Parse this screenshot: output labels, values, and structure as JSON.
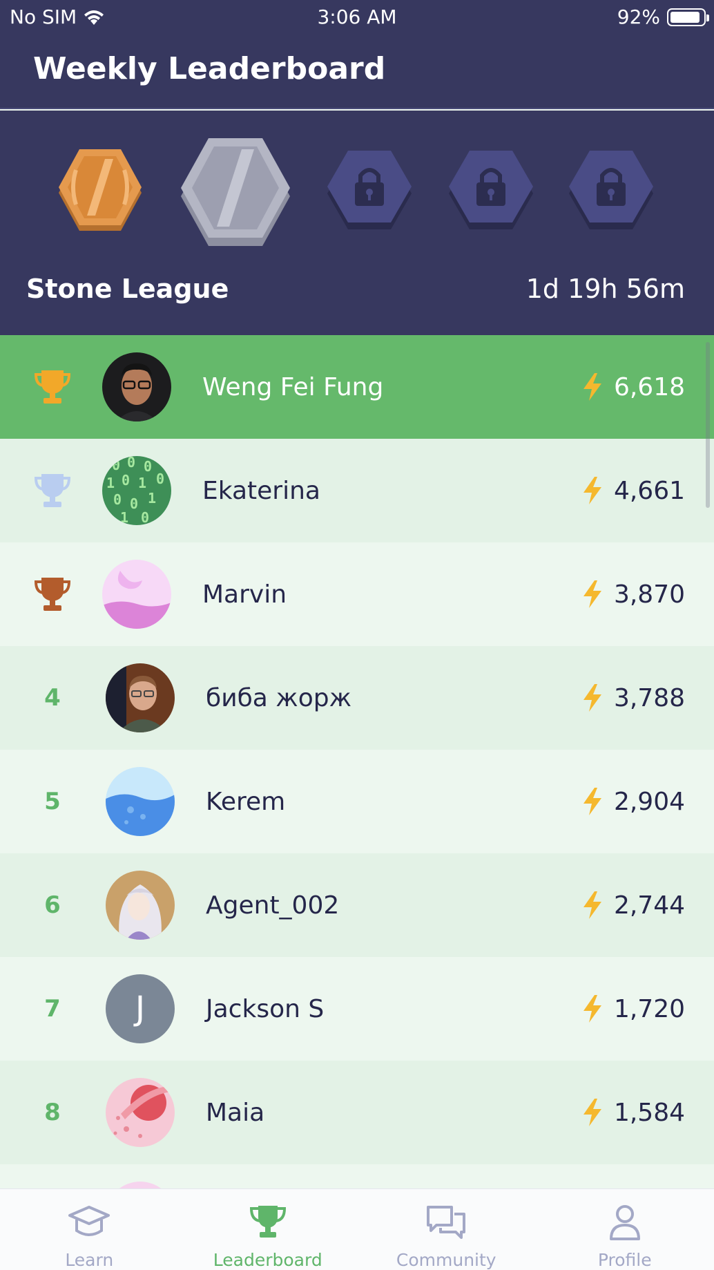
{
  "status_bar": {
    "carrier": "No SIM",
    "time": "3:06 AM",
    "battery": "92%",
    "battery_level": 0.92
  },
  "header": {
    "title": "Weekly Leaderboard"
  },
  "league": {
    "name": "Stone League",
    "countdown": "1d 19h 56m",
    "badges": [
      {
        "name": "bronze-league-badge",
        "state": "achieved"
      },
      {
        "name": "stone-league-badge",
        "state": "current"
      },
      {
        "name": "locked-league-badge-1",
        "state": "locked"
      },
      {
        "name": "locked-league-badge-2",
        "state": "locked"
      },
      {
        "name": "locked-league-badge-3",
        "state": "locked"
      }
    ]
  },
  "leaderboard": [
    {
      "rank": "1",
      "trophy": "gold",
      "name": "Weng Fei Fung",
      "score": "6,618",
      "avatar": "photo-man-glasses",
      "highlight": true
    },
    {
      "rank": "2",
      "trophy": "silver",
      "name": "Ekaterina",
      "score": "4,661",
      "avatar": "binary-code"
    },
    {
      "rank": "3",
      "trophy": "bronze",
      "name": "Marvin",
      "score": "3,870",
      "avatar": "pink-moon"
    },
    {
      "rank": "4",
      "name": "биба жорж",
      "score": "3,788",
      "avatar": "photo-man"
    },
    {
      "rank": "5",
      "name": "Kerem",
      "score": "2,904",
      "avatar": "blue-water"
    },
    {
      "rank": "6",
      "name": "Agent_002",
      "score": "2,744",
      "avatar": "anime-girl"
    },
    {
      "rank": "7",
      "name": "Jackson S",
      "score": "1,720",
      "avatar": "letter",
      "initial": "J"
    },
    {
      "rank": "8",
      "name": "Maia",
      "score": "1,584",
      "avatar": "pink-planet"
    }
  ],
  "tabs": [
    {
      "label": "Learn",
      "icon": "graduation-cap-icon",
      "active": false
    },
    {
      "label": "Leaderboard",
      "icon": "trophy-icon",
      "active": true
    },
    {
      "label": "Community",
      "icon": "chat-bubbles-icon",
      "active": false
    },
    {
      "label": "Profile",
      "icon": "person-icon",
      "active": false
    }
  ],
  "colors": {
    "header_bg": "#37385f",
    "highlight_row": "#65b96b",
    "row_a": "#e3f2e6",
    "row_b": "#edf7ef",
    "accent_green": "#5fb56a",
    "bolt": "#f5b82e",
    "gold": "#f2a829",
    "silver": "#b9cdf0",
    "bronze": "#b35c2c",
    "locked_badge": "#4a4c86"
  }
}
